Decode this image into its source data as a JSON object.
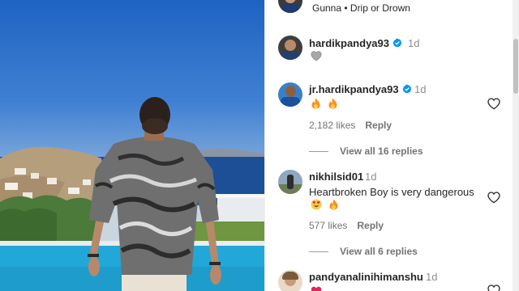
{
  "post": {
    "header_subtitle": "Gunna • Drip or Drown"
  },
  "caption": {
    "username": "hardikpandya93",
    "time": "1d",
    "emoji_icons": [
      "grey-heart-icon"
    ]
  },
  "comments": [
    {
      "username": "jr.hardikpandya93",
      "verified": true,
      "time": "1d",
      "text": "",
      "emoji_icons": [
        "fire-icon",
        "fire-icon"
      ],
      "likes": "2,182 likes",
      "reply_label": "Reply",
      "view_replies": "View all 16 replies"
    },
    {
      "username": "nikhilsid01",
      "verified": false,
      "time": "1d",
      "text": "Heartbroken Boy is very dangerous",
      "emoji_icons": [
        "heart-eyes-icon",
        "fire-icon"
      ],
      "likes": "577 likes",
      "reply_label": "Reply",
      "view_replies": "View all 6 replies"
    },
    {
      "username": "pandyanalinihimanshu",
      "verified": false,
      "time": "1d"
    }
  ],
  "colors": {
    "verified_blue": "#0095f6",
    "muted_text": "#737373",
    "fire_orange": "#f7931e"
  }
}
